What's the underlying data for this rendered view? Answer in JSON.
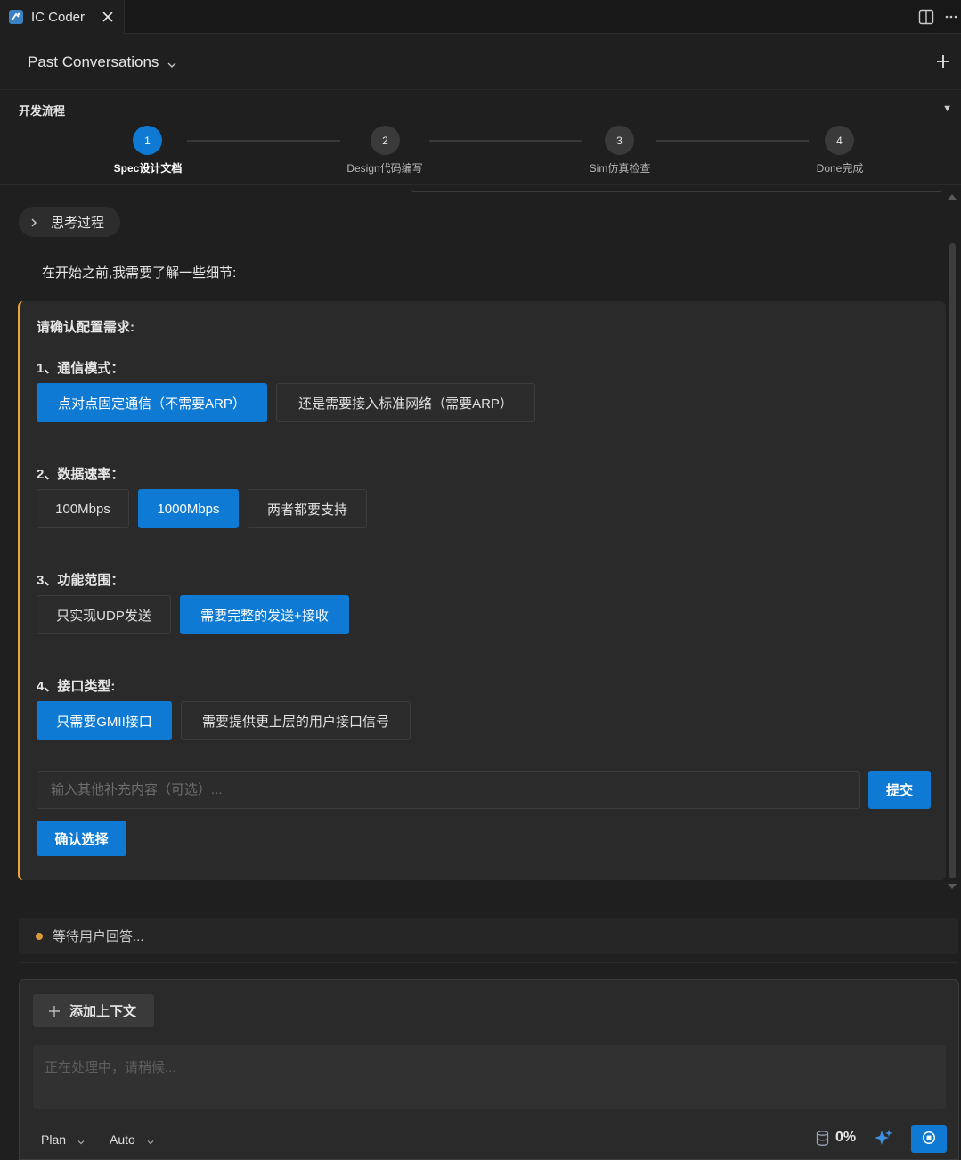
{
  "tab": {
    "title": "IC Coder"
  },
  "header": {
    "past_conversations": "Past Conversations"
  },
  "flow": {
    "title": "开发流程",
    "steps": [
      {
        "num": "1",
        "label": "Spec设计文档",
        "active": true
      },
      {
        "num": "2",
        "label": "Design代码编写",
        "active": false
      },
      {
        "num": "3",
        "label": "Sim仿真检查",
        "active": false
      },
      {
        "num": "4",
        "label": "Done完成",
        "active": false
      }
    ]
  },
  "thinking": {
    "label": "思考过程"
  },
  "intro": "在开始之前,我需要了解一些细节:",
  "card": {
    "title": "请确认配置需求:",
    "questions": [
      {
        "title": "1、通信模式：",
        "options": [
          "点对点固定通信（不需要ARP）",
          "还是需要接入标准网络（需要ARP）"
        ],
        "selected": 0
      },
      {
        "title": "2、数据速率：",
        "options": [
          "100Mbps",
          "1000Mbps",
          "两者都要支持"
        ],
        "selected": 1
      },
      {
        "title": "3、功能范围：",
        "options": [
          "只实现UDP发送",
          "需要完整的发送+接收"
        ],
        "selected": 1
      },
      {
        "title": "4、接口类型:",
        "options": [
          "只需要GMII接口",
          "需要提供更上层的用户接口信号"
        ],
        "selected": 0
      }
    ],
    "extra_placeholder": "输入其他补充内容（可选）...",
    "submit_label": "提交",
    "confirm_label": "确认选择"
  },
  "status": {
    "waiting": "等待用户回答..."
  },
  "composer": {
    "add_context": "添加上下文",
    "placeholder": "正在处理中，请稍候...",
    "mode": "Plan",
    "model": "Auto",
    "usage": "0%"
  },
  "colors": {
    "accent": "#0e7ad4",
    "card_border": "#e8a33a",
    "status_dot": "#d99a3c"
  }
}
